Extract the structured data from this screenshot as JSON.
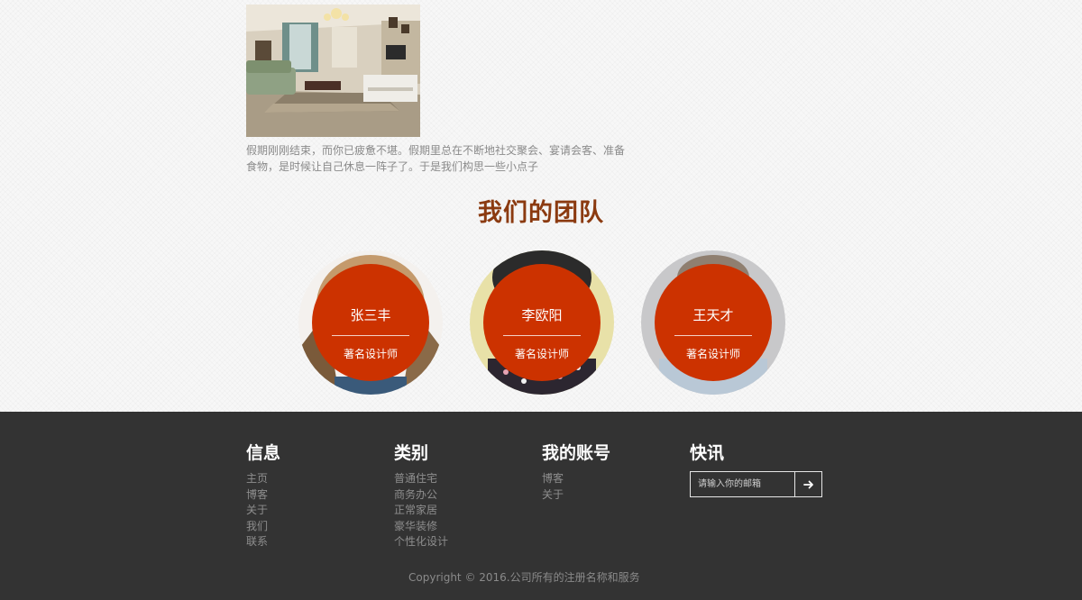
{
  "blog": {
    "excerpt": "假期刚刚结束，而你已疲惫不堪。假期里总在不断地社交聚会、宴请会客、准备食物，是时候让自己休息一阵子了。于是我们构思一些小点子"
  },
  "team": {
    "heading": "我们的团队",
    "members": [
      {
        "name": "张三丰",
        "title": "著名设计师"
      },
      {
        "name": "李欧阳",
        "title": "著名设计师"
      },
      {
        "name": "王天才",
        "title": "著名设计师"
      }
    ]
  },
  "footer": {
    "info": {
      "heading": "信息",
      "links": [
        "主页",
        "博客",
        "关于",
        "我们",
        "联系"
      ]
    },
    "categories": {
      "heading": "类别",
      "links": [
        "普通住宅",
        "商务办公",
        "正常家居",
        "豪华装修",
        "个性化设计"
      ]
    },
    "account": {
      "heading": "我的账号",
      "links": [
        "博客",
        "关于"
      ]
    },
    "newsletter": {
      "heading": "快讯",
      "placeholder": "请输入你的邮箱"
    },
    "copyright": "Copyright © 2016.公司所有的注册名称和服务"
  },
  "colors": {
    "accent": "#cc3200",
    "heading": "#8b3a10",
    "footer_bg": "#333333"
  },
  "icons": {
    "submit": "arrow-right-icon"
  }
}
